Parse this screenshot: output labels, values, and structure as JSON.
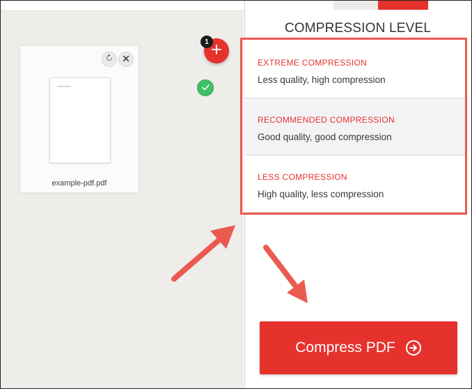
{
  "file": {
    "name": "example-pdf.pdf",
    "count_badge": "1"
  },
  "panel": {
    "title": "COMPRESSION LEVEL"
  },
  "options": [
    {
      "title": "EXTREME COMPRESSION",
      "description": "Less quality, high compression",
      "selected": false
    },
    {
      "title": "RECOMMENDED COMPRESSION",
      "description": "Good quality, good compression",
      "selected": true
    },
    {
      "title": "LESS COMPRESSION",
      "description": "High quality, less compression",
      "selected": false
    }
  ],
  "action": {
    "label": "Compress PDF"
  },
  "colors": {
    "accent": "#e5322d",
    "check": "#3fbf68",
    "annotation": "#ea5a4f"
  },
  "icons": {
    "rotate": "rotate-icon",
    "remove": "close-icon",
    "add": "plus-icon",
    "check": "checkmark-icon",
    "submit": "arrow-circle-right-icon"
  }
}
